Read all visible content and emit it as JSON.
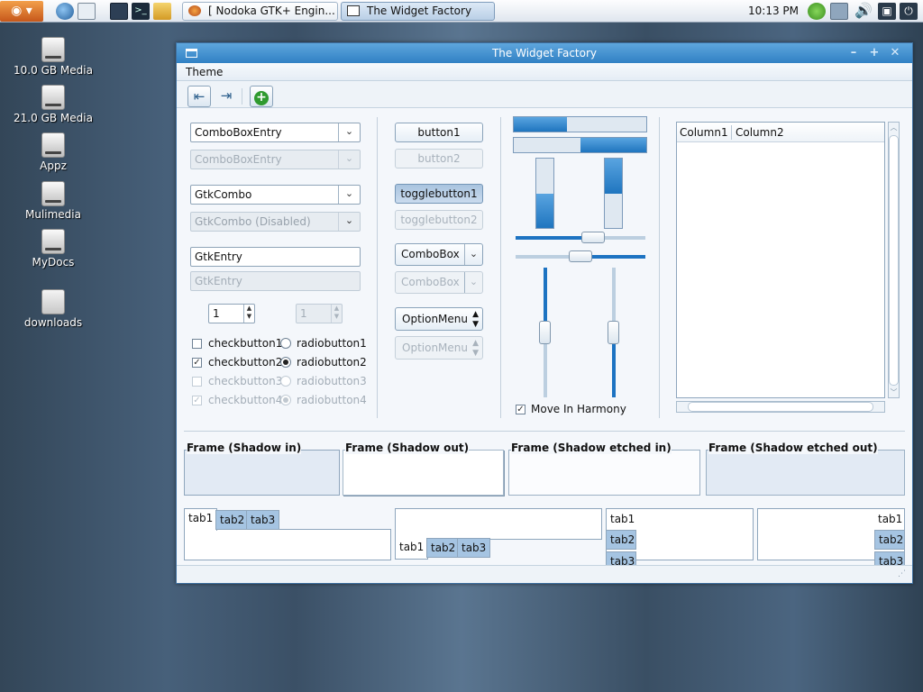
{
  "taskbar": {
    "tasks": [
      {
        "label": "[ Nodoka GTK+ Engin...",
        "active": false
      },
      {
        "label": "The Widget Factory",
        "active": true
      }
    ],
    "clock": "10:13 PM"
  },
  "desktop": {
    "icons": [
      {
        "label": "10.0 GB Media"
      },
      {
        "label": "21.0 GB Media"
      },
      {
        "label": "Appz"
      },
      {
        "label": "Mulimedia"
      },
      {
        "label": "MyDocs"
      },
      {
        "label": "downloads"
      }
    ]
  },
  "window": {
    "title": "The Widget Factory",
    "menu": {
      "theme": "Theme"
    },
    "col1": {
      "comboentry": "ComboBoxEntry",
      "comboentry_dis": "ComboBoxEntry",
      "gtkcombo": "GtkCombo",
      "gtkcombo_dis": "GtkCombo (Disabled)",
      "entry": "GtkEntry",
      "entry_dis": "GtkEntry",
      "spin": "1",
      "spin_dis": "1",
      "check1": "checkbutton1",
      "check2": "checkbutton2",
      "check3": "checkbutton3",
      "check4": "checkbutton4",
      "radio1": "radiobutton1",
      "radio2": "radiobutton2",
      "radio3": "radiobutton3",
      "radio4": "radiobutton4"
    },
    "col2": {
      "button1": "button1",
      "button2": "button2",
      "toggle1": "togglebutton1",
      "toggle2": "togglebutton2",
      "combobox": "ComboBox",
      "combobox_dis": "ComboBox",
      "optionmenu": "OptionMenu",
      "optionmenu_dis": "OptionMenu"
    },
    "col3": {
      "progress_h1": 0.4,
      "progress_h2": 0.5,
      "progress_v1": 0.5,
      "progress_v2": 0.5,
      "hscale1": 0.6,
      "hscale2": 0.5,
      "vscale1": 0.5,
      "vscale2": 0.5,
      "harmony": "Move In Harmony"
    },
    "tree": {
      "columns": [
        "Column1",
        "Column2"
      ]
    },
    "frames": [
      "Frame (Shadow in)",
      "Frame (Shadow out)",
      "Frame (Shadow etched in)",
      "Frame (Shadow etched out)"
    ],
    "tabs": [
      "tab1",
      "tab2",
      "tab3"
    ]
  },
  "colors": {
    "accent": "#1d73c2",
    "titlebar": "#3a8bcf"
  }
}
